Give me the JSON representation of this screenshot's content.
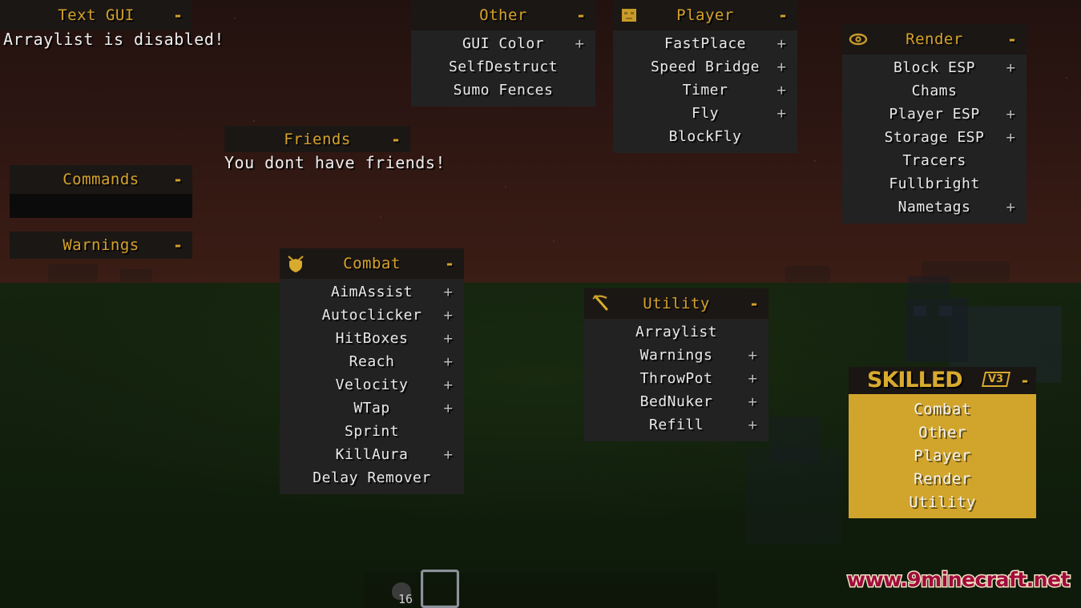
{
  "theme": {
    "accent_gold": "#d4a12b",
    "panel_body": "#222222",
    "panel_header": "#1b1714",
    "text_white": "#e9e9e9",
    "skilled_body": "#d1a52c",
    "watermark_color": "#a00b3c"
  },
  "panels": {
    "text_gui": {
      "title": "Text GUI",
      "toggle": "-",
      "message": "Arraylist is disabled!"
    },
    "commands": {
      "title": "Commands",
      "toggle": "-",
      "input_value": ""
    },
    "warnings": {
      "title": "Warnings",
      "toggle": "-"
    },
    "friends": {
      "title": "Friends",
      "toggle": "-",
      "message": "You dont have friends!"
    },
    "other": {
      "title": "Other",
      "toggle": "-",
      "items": [
        {
          "label": "GUI Color",
          "expand": "+"
        },
        {
          "label": "SelfDestruct",
          "expand": ""
        },
        {
          "label": "Sumo Fences",
          "expand": ""
        }
      ]
    },
    "player": {
      "title": "Player",
      "toggle": "-",
      "icon": "player-head-icon",
      "items": [
        {
          "label": "FastPlace",
          "expand": "+"
        },
        {
          "label": "Speed Bridge",
          "expand": "+"
        },
        {
          "label": "Timer",
          "expand": "+"
        },
        {
          "label": "Fly",
          "expand": "+"
        },
        {
          "label": "BlockFly",
          "expand": ""
        }
      ]
    },
    "render": {
      "title": "Render",
      "toggle": "-",
      "icon": "eye-icon",
      "items": [
        {
          "label": "Block ESP",
          "expand": "+"
        },
        {
          "label": "Chams",
          "expand": ""
        },
        {
          "label": "Player ESP",
          "expand": "+"
        },
        {
          "label": "Storage ESP",
          "expand": "+"
        },
        {
          "label": "Tracers",
          "expand": ""
        },
        {
          "label": "Fullbright",
          "expand": ""
        },
        {
          "label": "Nametags",
          "expand": "+"
        }
      ]
    },
    "combat": {
      "title": "Combat",
      "toggle": "-",
      "icon": "crossed-swords-shield-icon",
      "items": [
        {
          "label": "AimAssist",
          "expand": "+"
        },
        {
          "label": "Autoclicker",
          "expand": "+"
        },
        {
          "label": "HitBoxes",
          "expand": "+"
        },
        {
          "label": "Reach",
          "expand": "+"
        },
        {
          "label": "Velocity",
          "expand": "+"
        },
        {
          "label": "WTap",
          "expand": "+"
        },
        {
          "label": "Sprint",
          "expand": ""
        },
        {
          "label": "KillAura",
          "expand": "+"
        },
        {
          "label": "Delay Remover",
          "expand": ""
        }
      ]
    },
    "utility": {
      "title": "Utility",
      "toggle": "-",
      "icon": "pickaxe-icon",
      "items": [
        {
          "label": "Arraylist",
          "expand": ""
        },
        {
          "label": "Warnings",
          "expand": "+"
        },
        {
          "label": "ThrowPot",
          "expand": "+"
        },
        {
          "label": "BedNuker",
          "expand": "+"
        },
        {
          "label": "Refill",
          "expand": "+"
        }
      ]
    },
    "skilled": {
      "logo": "SKILLED",
      "version_badge": "V3",
      "toggle": "-",
      "items": [
        {
          "label": "Combat"
        },
        {
          "label": "Other"
        },
        {
          "label": "Player"
        },
        {
          "label": "Render"
        },
        {
          "label": "Utility"
        }
      ]
    }
  },
  "hud": {
    "hotbar_item_count": "16"
  },
  "watermark": {
    "text": "www.9minecraft.net"
  }
}
